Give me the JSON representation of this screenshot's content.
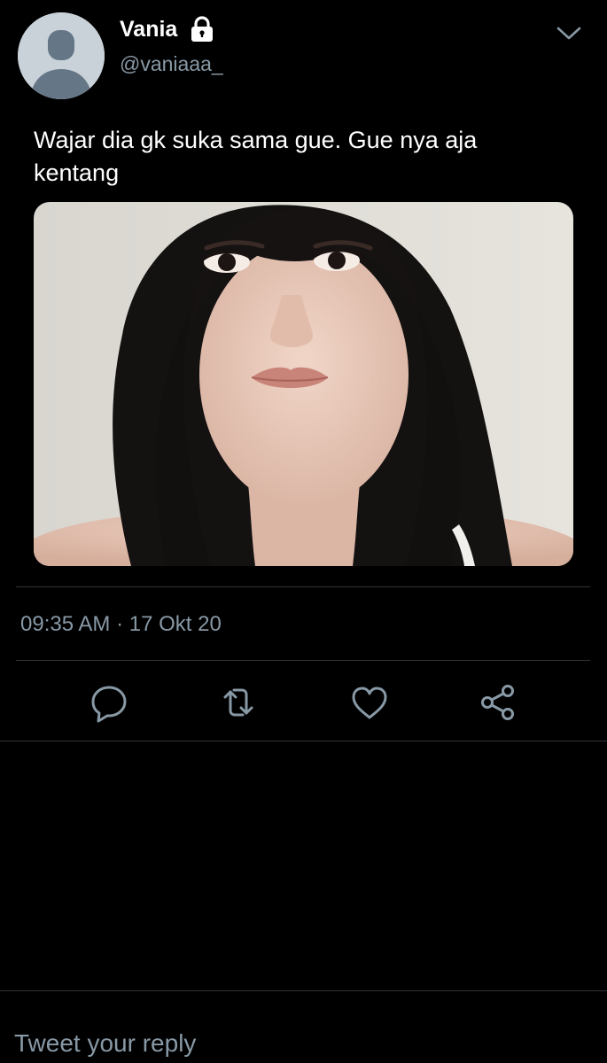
{
  "author": {
    "display_name": "Vania",
    "handle": "@vaniaaa_",
    "protected_icon": "lock-icon",
    "avatar": "default-avatar-placeholder"
  },
  "menu": {
    "icon": "chevron-down-icon"
  },
  "tweet": {
    "text": "Wajar dia gk suka sama gue. Gue nya aja kentang",
    "media": "photo of a young woman with long dark hair",
    "timestamp": "09:35 AM · 17 Okt 20"
  },
  "actions": [
    {
      "name": "reply",
      "icon": "reply-icon"
    },
    {
      "name": "retweet",
      "icon": "retweet-icon"
    },
    {
      "name": "like",
      "icon": "heart-icon"
    },
    {
      "name": "share",
      "icon": "share-icon"
    }
  ],
  "composer": {
    "placeholder": "Tweet your reply"
  },
  "colors": {
    "background": "#000000",
    "primary_text": "#ffffff",
    "secondary_text": "#8899a6",
    "divider": "#2f3336",
    "avatar_bg": "#c9d1d9",
    "avatar_silhouette": "#657786"
  }
}
